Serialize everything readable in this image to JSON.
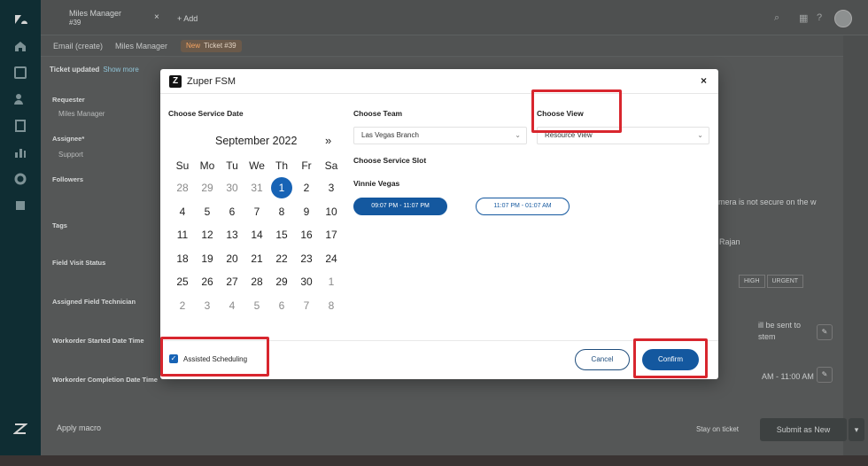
{
  "app": {
    "tab_title": "Miles Manager",
    "tab_subtitle": "#39",
    "add_tab_label": "+ Add",
    "breadcrumbs": [
      "Email (create)",
      "Miles Manager"
    ],
    "ticket_badge_new": "New",
    "ticket_badge_label": "Ticket #39",
    "banner_title": "Ticket updated",
    "banner_link": "Show more",
    "left_fields": [
      {
        "label": "Requester",
        "value": "Miles Manager"
      },
      {
        "label": "Assignee*",
        "value": "Support"
      },
      {
        "label": "Followers",
        "value": ""
      },
      {
        "label": "Tags",
        "value": ""
      },
      {
        "label": "Field Visit Status",
        "value": ""
      },
      {
        "label": "Assigned Field Technician",
        "value": ""
      },
      {
        "label": "Workorder Started Date Time",
        "value": ""
      },
      {
        "label": "Workorder Completion Date Time",
        "value": ""
      }
    ],
    "apply_macro": "Apply macro",
    "right_texts": [
      "amera is not secure on the w",
      "Rajan",
      "ill be sent to",
      "stem",
      "AM - 11:00 AM"
    ],
    "priority_pills": [
      "HIGH",
      "URGENT"
    ],
    "stay_on_ticket": "Stay on ticket",
    "submit_label": "Submit as New"
  },
  "modal": {
    "logo_letter": "Z",
    "title": "Zuper FSM",
    "close_glyph": "×",
    "service_date_label": "Choose Service Date",
    "calendar": {
      "month_label": "September 2022",
      "next_glyph": "»",
      "weekdays": [
        "Su",
        "Mo",
        "Tu",
        "We",
        "Th",
        "Fr",
        "Sa"
      ],
      "weeks": [
        [
          "28",
          "29",
          "30",
          "31",
          "1",
          "2",
          "3"
        ],
        [
          "4",
          "5",
          "6",
          "7",
          "8",
          "9",
          "10"
        ],
        [
          "11",
          "12",
          "13",
          "14",
          "15",
          "16",
          "17"
        ],
        [
          "18",
          "19",
          "20",
          "21",
          "22",
          "23",
          "24"
        ],
        [
          "25",
          "26",
          "27",
          "28",
          "29",
          "30",
          "1"
        ],
        [
          "2",
          "3",
          "4",
          "5",
          "6",
          "7",
          "8"
        ]
      ],
      "muted": [
        [
          0,
          0
        ],
        [
          0,
          1
        ],
        [
          0,
          2
        ],
        [
          0,
          3
        ],
        [
          4,
          6
        ],
        [
          5,
          0
        ],
        [
          5,
          1
        ],
        [
          5,
          2
        ],
        [
          5,
          3
        ],
        [
          5,
          4
        ],
        [
          5,
          5
        ],
        [
          5,
          6
        ]
      ],
      "selected": [
        0,
        4
      ]
    },
    "team_label": "Choose Team",
    "team_value": "Las Vegas Branch",
    "view_label": "Choose View",
    "view_value": "Resource View",
    "slot_label": "Choose Service Slot",
    "technician": "Vinnie Vegas",
    "slots": [
      "09:07 PM - 11:07 PM",
      "11:07 PM - 01:07 AM"
    ],
    "assisted_scheduling_label": "Assisted Scheduling",
    "assisted_scheduling_checked": true,
    "cancel_label": "Cancel",
    "confirm_label": "Confirm"
  },
  "colors": {
    "primary": "#14589f",
    "annotation": "#d8262e",
    "sidebar": "#0f2d33"
  }
}
